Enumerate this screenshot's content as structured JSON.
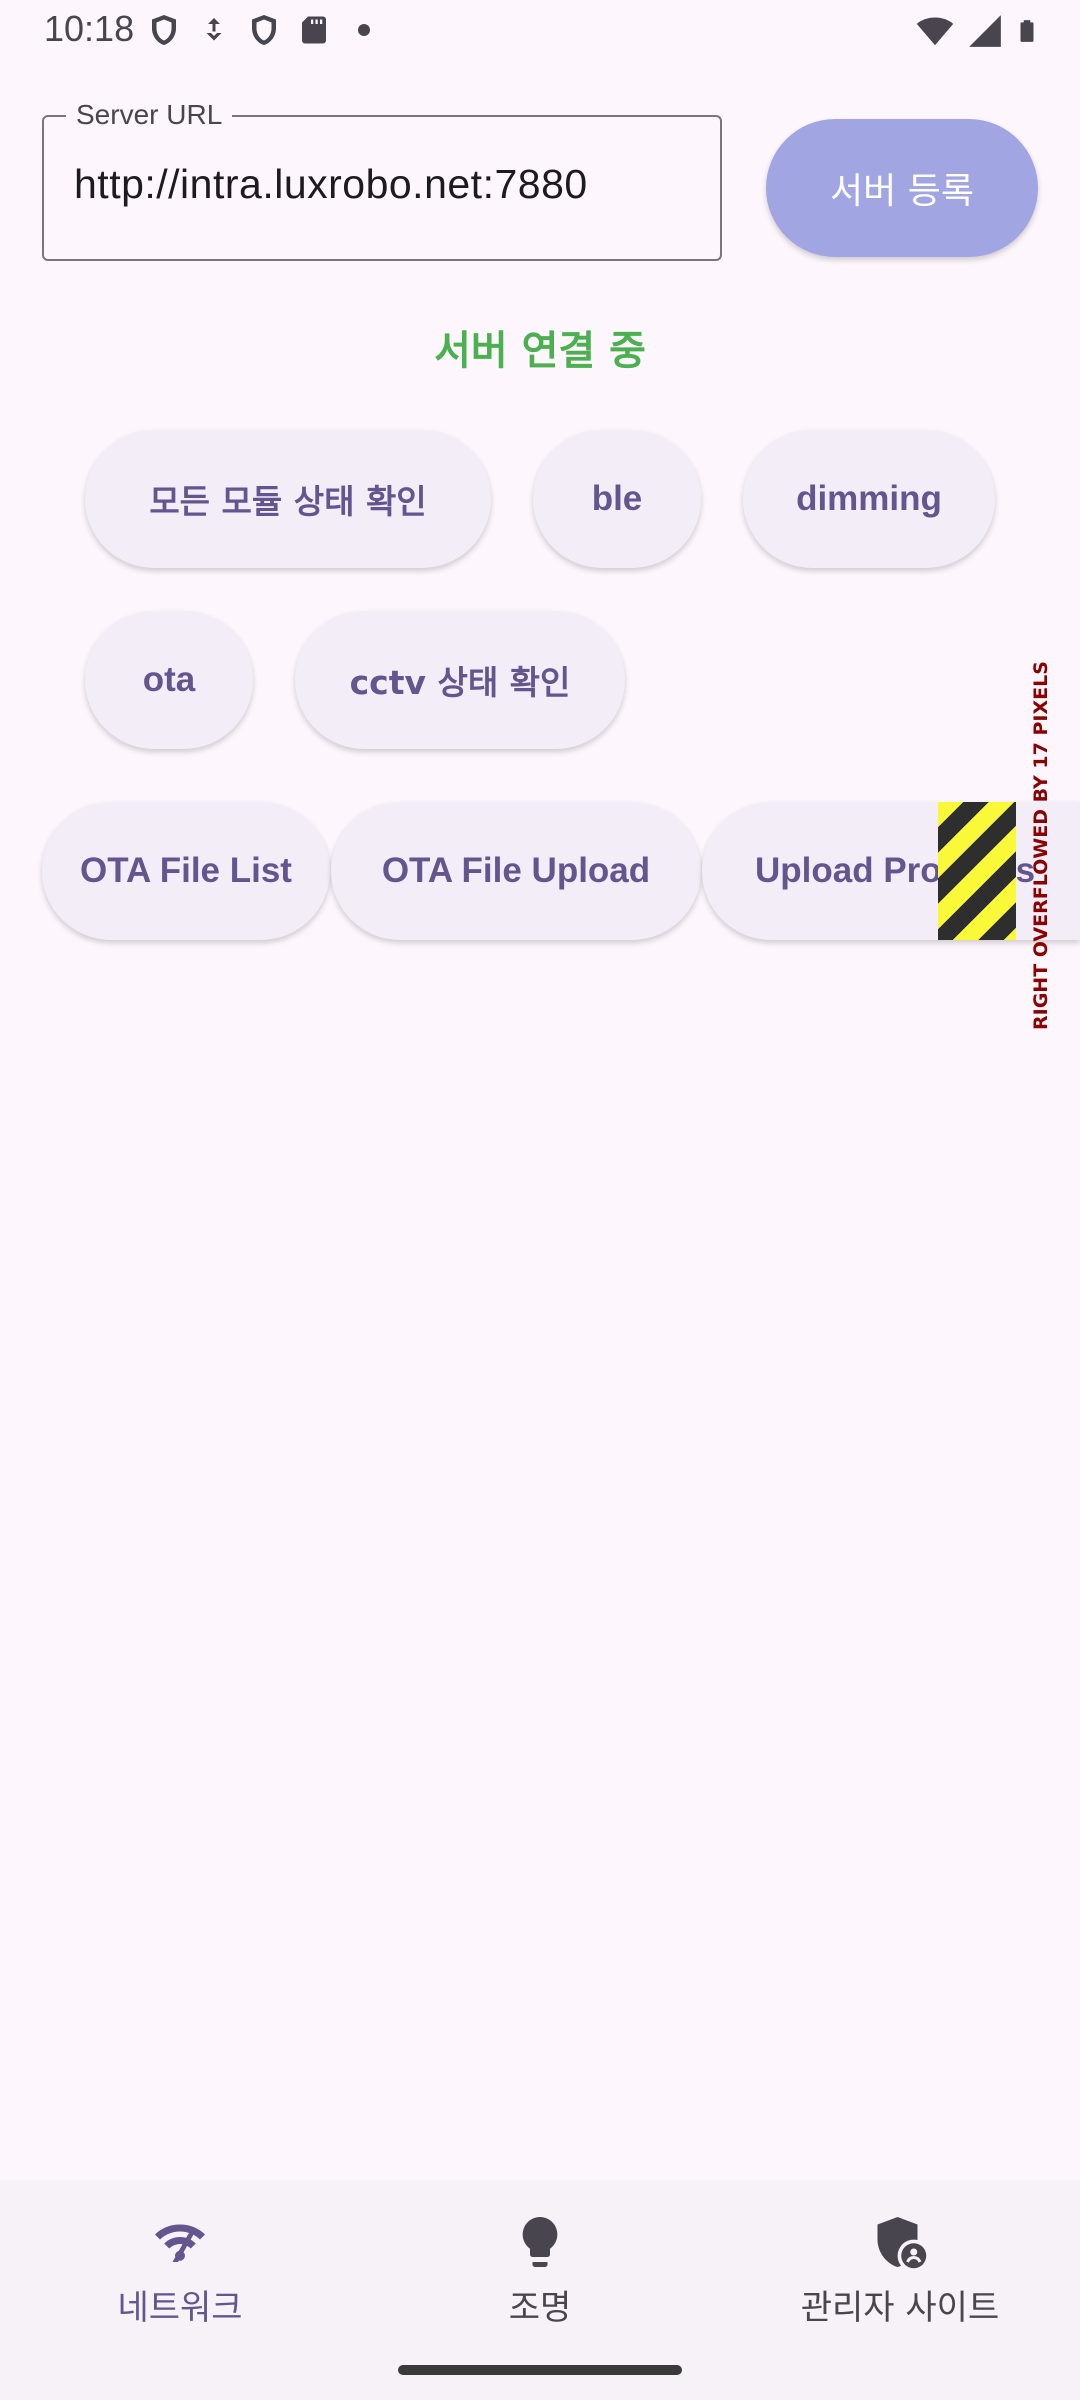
{
  "status_bar": {
    "time": "10:18",
    "left_icons": [
      "shield-icon",
      "download-icon",
      "shield-icon",
      "sd-card-icon",
      "dot-icon"
    ],
    "right_icons": [
      "wifi-icon",
      "signal-icon",
      "battery-icon"
    ]
  },
  "server": {
    "label": "Server URL",
    "value": "http://intra.luxrobo.net:7880",
    "register_label": "서버 등록",
    "status": "서버 연결 중",
    "status_color": "#4CAF50"
  },
  "action_chips": [
    "모든 모듈 상태 확인",
    "ble",
    "dimming",
    "ota",
    "cctv 상태 확인"
  ],
  "ota_buttons": [
    "OTA File List",
    "OTA File Upload",
    "Upload Progress"
  ],
  "overflow_warning": "RIGHT OVERFLOWED BY 17 PIXELS",
  "bottom_nav": {
    "items": [
      {
        "label": "네트워크",
        "icon": "network-icon",
        "active": true
      },
      {
        "label": "조명",
        "icon": "lightbulb-icon",
        "active": false
      },
      {
        "label": "관리자 사이트",
        "icon": "admin-shield-icon",
        "active": false
      }
    ]
  },
  "colors": {
    "background": "#FDF7FD",
    "accent": "#65558F",
    "register_button": "#A1A5E2",
    "chip_bg": "#F3EDF7"
  }
}
